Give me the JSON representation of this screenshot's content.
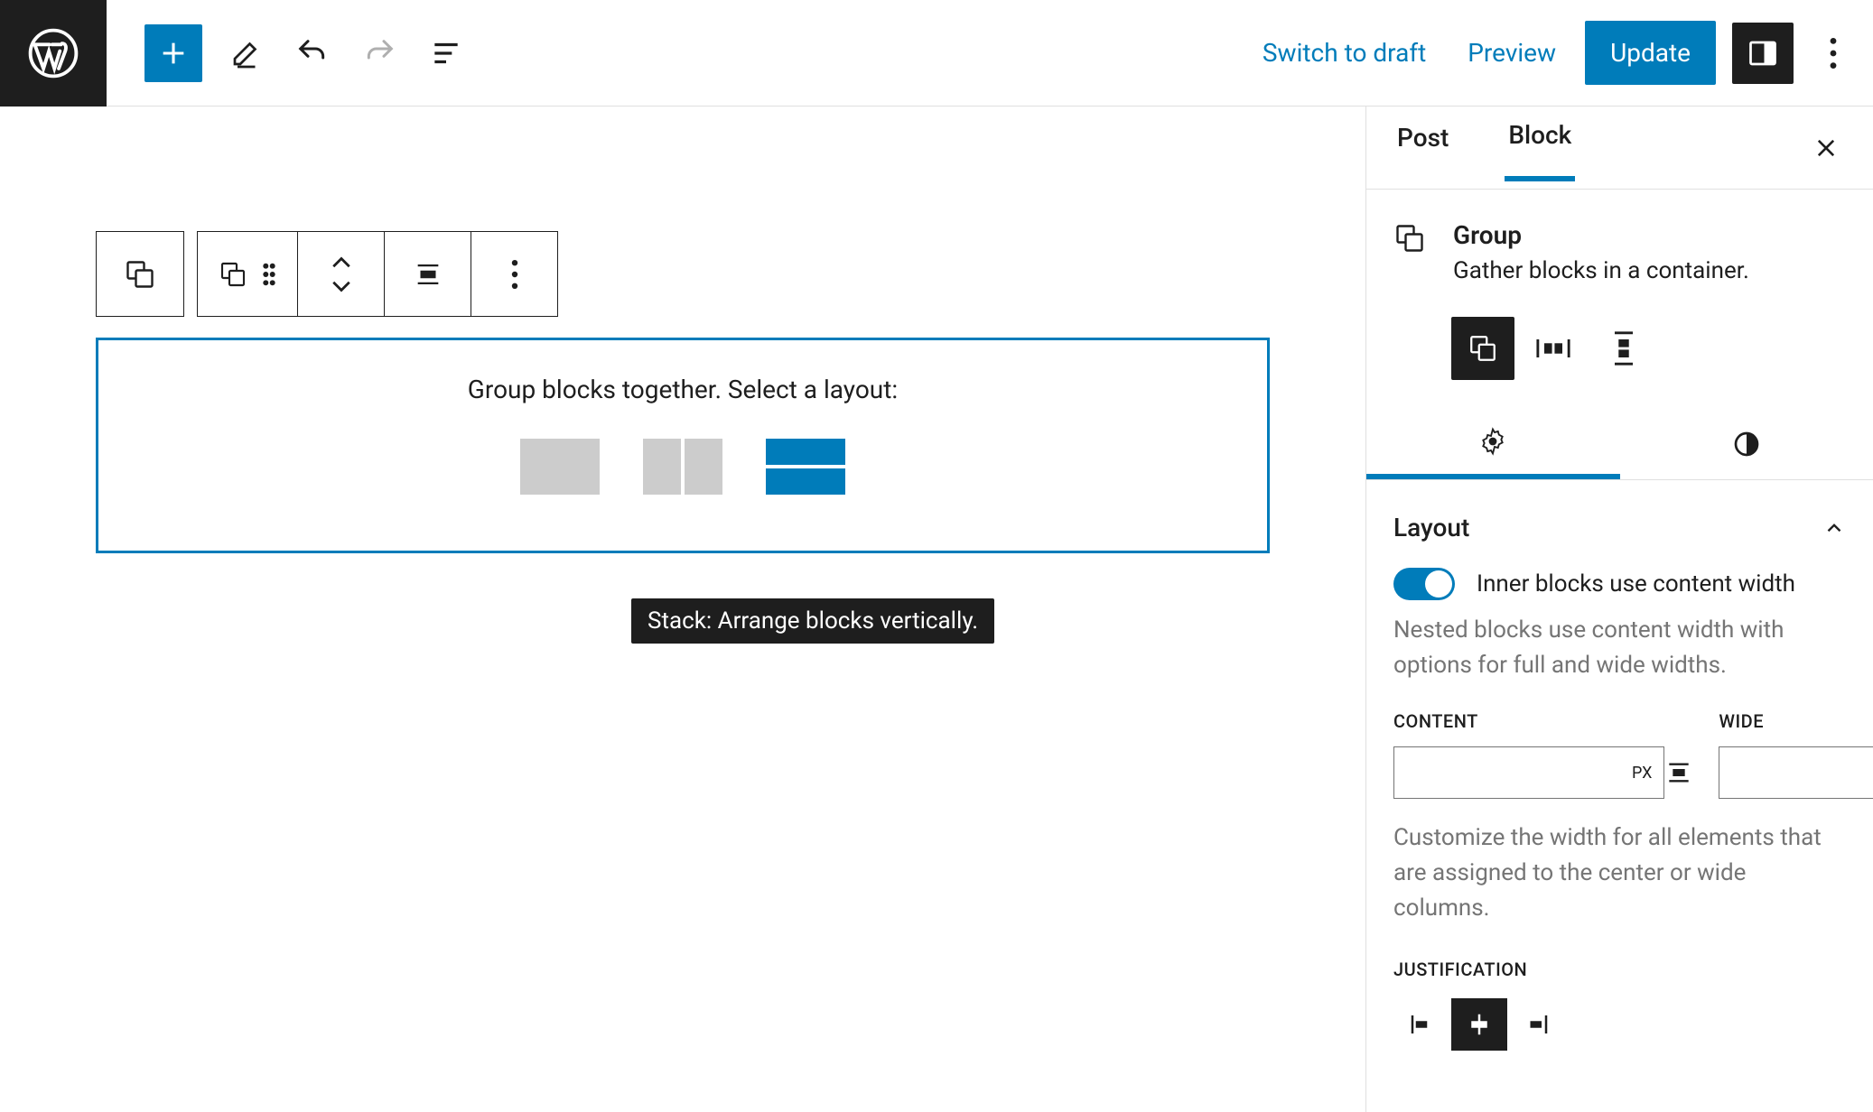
{
  "topbar": {
    "switch_draft": "Switch to draft",
    "preview": "Preview",
    "update": "Update"
  },
  "canvas": {
    "layout_prompt": "Group blocks together. Select a layout:",
    "tooltip": "Stack: Arrange blocks vertically."
  },
  "sidebar": {
    "tabs": {
      "post": "Post",
      "block": "Block"
    },
    "block": {
      "title": "Group",
      "description": "Gather blocks in a container."
    },
    "panel": {
      "layout_title": "Layout",
      "toggle_label": "Inner blocks use content width",
      "toggle_help": "Nested blocks use content width with options for full and wide widths.",
      "content_label": "CONTENT",
      "wide_label": "WIDE",
      "unit": "PX",
      "width_help": "Customize the width for all elements that are assigned to the center or wide columns.",
      "justification_label": "JUSTIFICATION"
    }
  },
  "icon_names": {
    "wp": "wordpress-icon",
    "add": "plus-icon",
    "tools": "pencil-icon",
    "undo": "undo-icon",
    "redo": "redo-icon",
    "outline": "list-view-icon",
    "sidebar_toggle": "settings-sidebar-icon",
    "more": "more-vertical-icon",
    "group": "group-icon",
    "row": "row-icon",
    "stack": "stack-icon",
    "settings": "gear-icon",
    "styles": "half-circle-icon",
    "close": "close-icon",
    "chevron_up": "chevron-up-icon",
    "align_left": "justify-left-icon",
    "align_center": "justify-center-icon",
    "align_right": "justify-right-icon",
    "content_width": "content-width-icon",
    "wide_width": "wide-width-icon",
    "drag": "drag-handle-icon",
    "move": "move-up-down-icon",
    "align": "align-icon"
  }
}
